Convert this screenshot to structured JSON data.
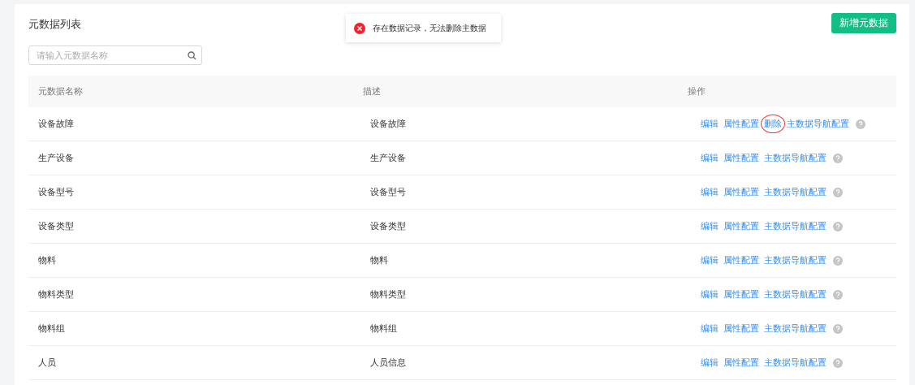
{
  "title": "元数据列表",
  "toast": {
    "kind": "error",
    "message": "存在数据记录，无法删除主数据"
  },
  "add_button": "新增元数据",
  "search": {
    "placeholder": "请输入元数据名称"
  },
  "table": {
    "columns": [
      "元数据名称",
      "描述",
      "操作"
    ],
    "rows": [
      {
        "name": "设备故障",
        "description": "设备故障",
        "actions": [
          {
            "label": "编辑",
            "circled": false
          },
          {
            "label": "属性配置",
            "circled": false
          },
          {
            "label": "删除",
            "circled": true
          },
          {
            "label": "主数据导航配置",
            "circled": false
          }
        ]
      },
      {
        "name": "生产设备",
        "description": "生产设备",
        "actions": [
          {
            "label": "编辑",
            "circled": false
          },
          {
            "label": "属性配置",
            "circled": false
          },
          {
            "label": "主数据导航配置",
            "circled": false
          }
        ]
      },
      {
        "name": "设备型号",
        "description": "设备型号",
        "actions": [
          {
            "label": "编辑",
            "circled": false
          },
          {
            "label": "属性配置",
            "circled": false
          },
          {
            "label": "主数据导航配置",
            "circled": false
          }
        ]
      },
      {
        "name": "设备类型",
        "description": "设备类型",
        "actions": [
          {
            "label": "编辑",
            "circled": false
          },
          {
            "label": "属性配置",
            "circled": false
          },
          {
            "label": "主数据导航配置",
            "circled": false
          }
        ]
      },
      {
        "name": "物料",
        "description": "物料",
        "actions": [
          {
            "label": "编辑",
            "circled": false
          },
          {
            "label": "属性配置",
            "circled": false
          },
          {
            "label": "主数据导航配置",
            "circled": false
          }
        ]
      },
      {
        "name": "物料类型",
        "description": "物料类型",
        "actions": [
          {
            "label": "编辑",
            "circled": false
          },
          {
            "label": "属性配置",
            "circled": false
          },
          {
            "label": "主数据导航配置",
            "circled": false
          }
        ]
      },
      {
        "name": "物料组",
        "description": "物料组",
        "actions": [
          {
            "label": "编辑",
            "circled": false
          },
          {
            "label": "属性配置",
            "circled": false
          },
          {
            "label": "主数据导航配置",
            "circled": false
          }
        ]
      },
      {
        "name": "人员",
        "description": "人员信息",
        "actions": [
          {
            "label": "编辑",
            "circled": false
          },
          {
            "label": "属性配置",
            "circled": false
          },
          {
            "label": "主数据导航配置",
            "circled": false
          }
        ]
      }
    ]
  }
}
